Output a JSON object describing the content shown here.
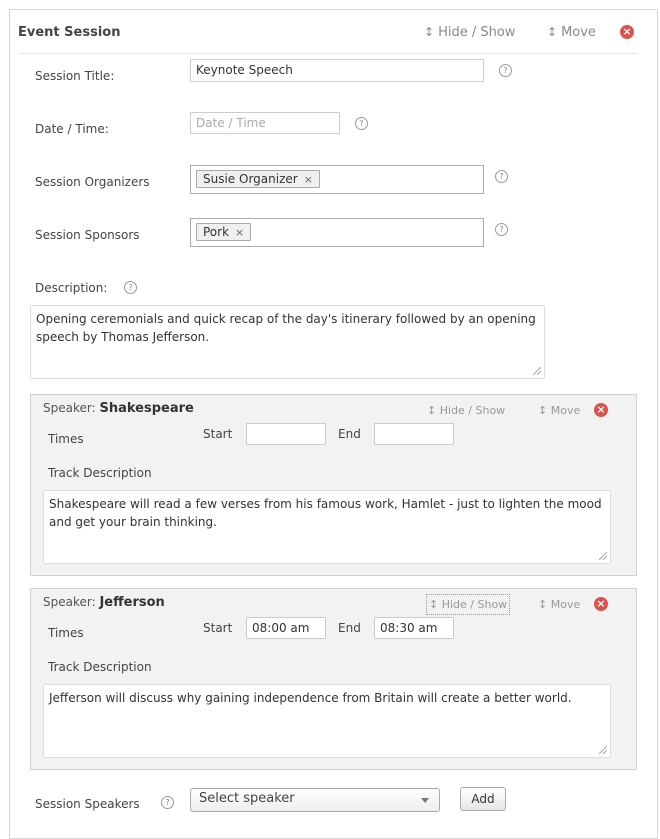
{
  "panel": {
    "title": "Event Session",
    "hide_show": "Hide / Show",
    "move": "Move",
    "move_arrow": "↕",
    "remove_icon": "×"
  },
  "fields": {
    "session_title": {
      "label": "Session Title:",
      "value": "Keynote Speech"
    },
    "date_time": {
      "label": "Date / Time:",
      "placeholder": "Date / Time"
    },
    "organizers": {
      "label": "Session Organizers",
      "tokens": [
        "Susie Organizer"
      ]
    },
    "sponsors": {
      "label": "Session Sponsors",
      "tokens": [
        "Pork"
      ]
    },
    "description": {
      "label": "Description:",
      "value": "Opening ceremonials and quick recap of the day's itinerary followed by an opening speech by Thomas Jefferson."
    },
    "help_glyph": "?",
    "token_remove": "×"
  },
  "speakers": [
    {
      "prefix": "Speaker:",
      "name": "Shakespeare",
      "times_label": "Times",
      "start_label": "Start",
      "start_value": "",
      "end_label": "End",
      "end_value": "",
      "track_label": "Track Description",
      "track_value": "Shakespeare will read a few verses from his famous work, Hamlet - just to lighten the mood and get your brain thinking."
    },
    {
      "prefix": "Speaker:",
      "name": "Jefferson",
      "times_label": "Times",
      "start_label": "Start",
      "start_value": "08:00 am",
      "end_label": "End",
      "end_value": "08:30 am",
      "track_label": "Track Description",
      "track_value": "Jefferson will discuss why gaining independence from Britain will create a better world."
    }
  ],
  "session_speakers": {
    "label": "Session Speakers",
    "select_value": "Select speaker",
    "add_button": "Add"
  },
  "colors": {
    "remove": "#d9534f",
    "speaker_bg": "#f2f2f2"
  }
}
